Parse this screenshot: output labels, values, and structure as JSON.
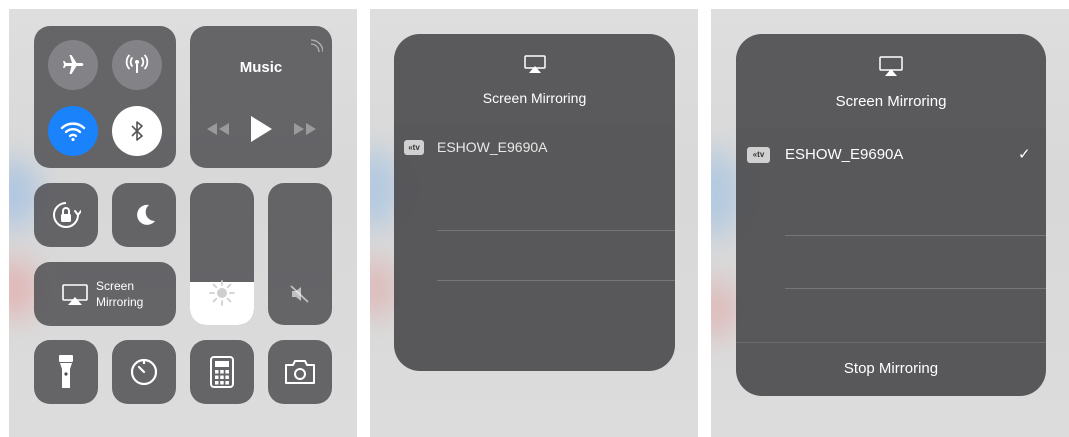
{
  "control_center": {
    "music_label": "Music",
    "screen_mirroring_line1": "Screen",
    "screen_mirroring_line2": "Mirroring"
  },
  "mirroring_list": {
    "title": "Screen Mirroring",
    "device_badge": "«tv",
    "device_name": "ESHOW_E9690A"
  },
  "mirroring_connected": {
    "title": "Screen Mirroring",
    "device_badge": "«tv",
    "device_name": "ESHOW_E9690A",
    "checkmark": "✓",
    "stop_label": "Stop Mirroring"
  },
  "colors": {
    "wifi_blue": "#1a82fb",
    "tile_gray": "#4b4b4e",
    "white": "#ffffff"
  }
}
